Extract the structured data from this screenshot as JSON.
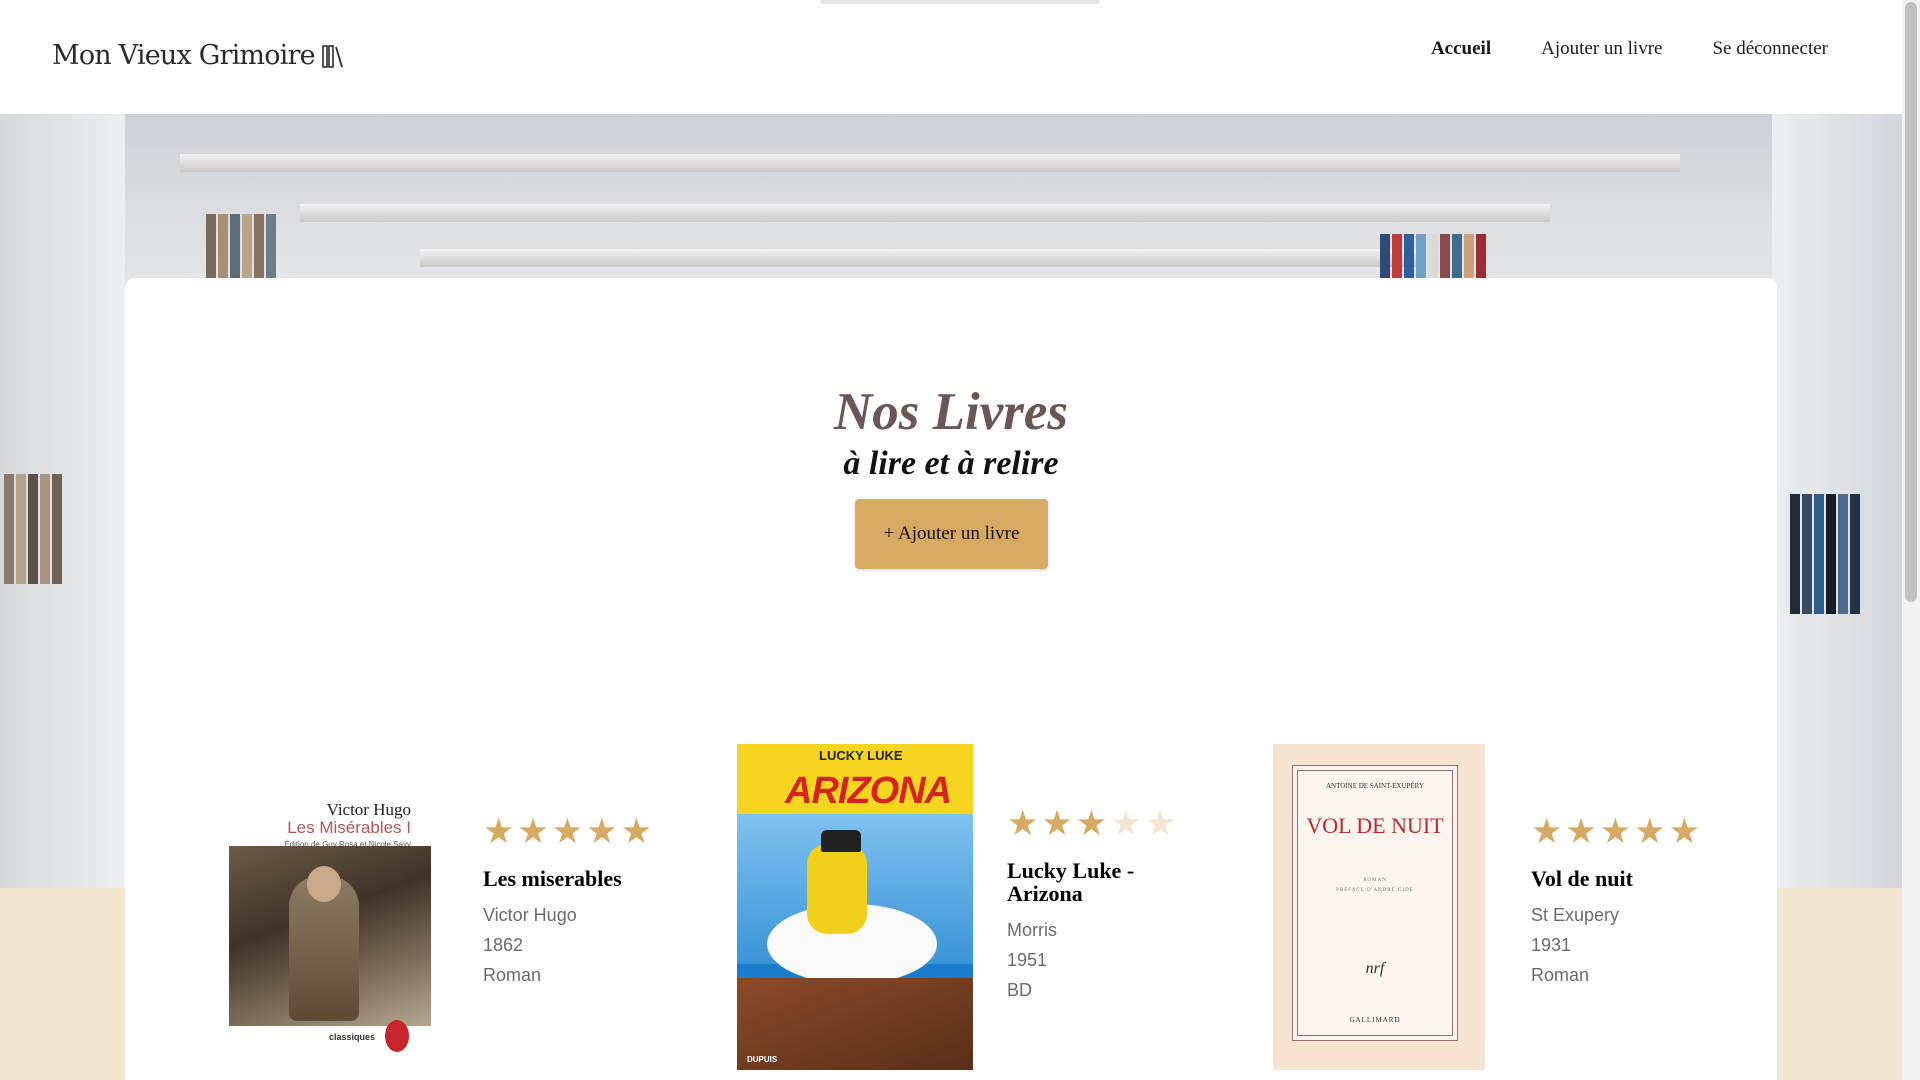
{
  "header": {
    "logo_text": "Mon Vieux Grimoire",
    "nav": {
      "home": "Accueil",
      "add_book": "Ajouter un livre",
      "logout": "Se déconnecter"
    }
  },
  "main": {
    "title": "Nos Livres",
    "subtitle": "à lire et à relire",
    "add_button": "+ Ajouter un livre"
  },
  "books": [
    {
      "title": "Les miserables",
      "author": "Victor Hugo",
      "year": "1862",
      "genre": "Roman",
      "rating": 5,
      "cover": {
        "author": "Victor Hugo",
        "title": "Les Misérables I",
        "edition": "Édition de Guy Rosa et Nicole Savy",
        "collection": "classiques"
      }
    },
    {
      "title": "Lucky Luke - Arizona",
      "author": "Morris",
      "year": "1951",
      "genre": "BD",
      "rating": 3,
      "cover": {
        "series": "LUCKY LUKE",
        "title": "ARIZONA",
        "publisher": "DUPUIS"
      }
    },
    {
      "title": "Vol de nuit",
      "author": "St Exupery",
      "year": "1931",
      "genre": "Roman",
      "rating": 5,
      "cover": {
        "author": "ANTOINE DE SAINT-EXUPÉRY",
        "title": "VOL DE NUIT",
        "type": "ROMAN",
        "preface": "PRÉFACE D'ANDRÉ GIDE",
        "mark": "nrf",
        "publisher": "GALLIMARD"
      }
    }
  ],
  "colors": {
    "accent": "#d7a962",
    "title": "#6a5654",
    "beige": "#f3e6d2"
  }
}
